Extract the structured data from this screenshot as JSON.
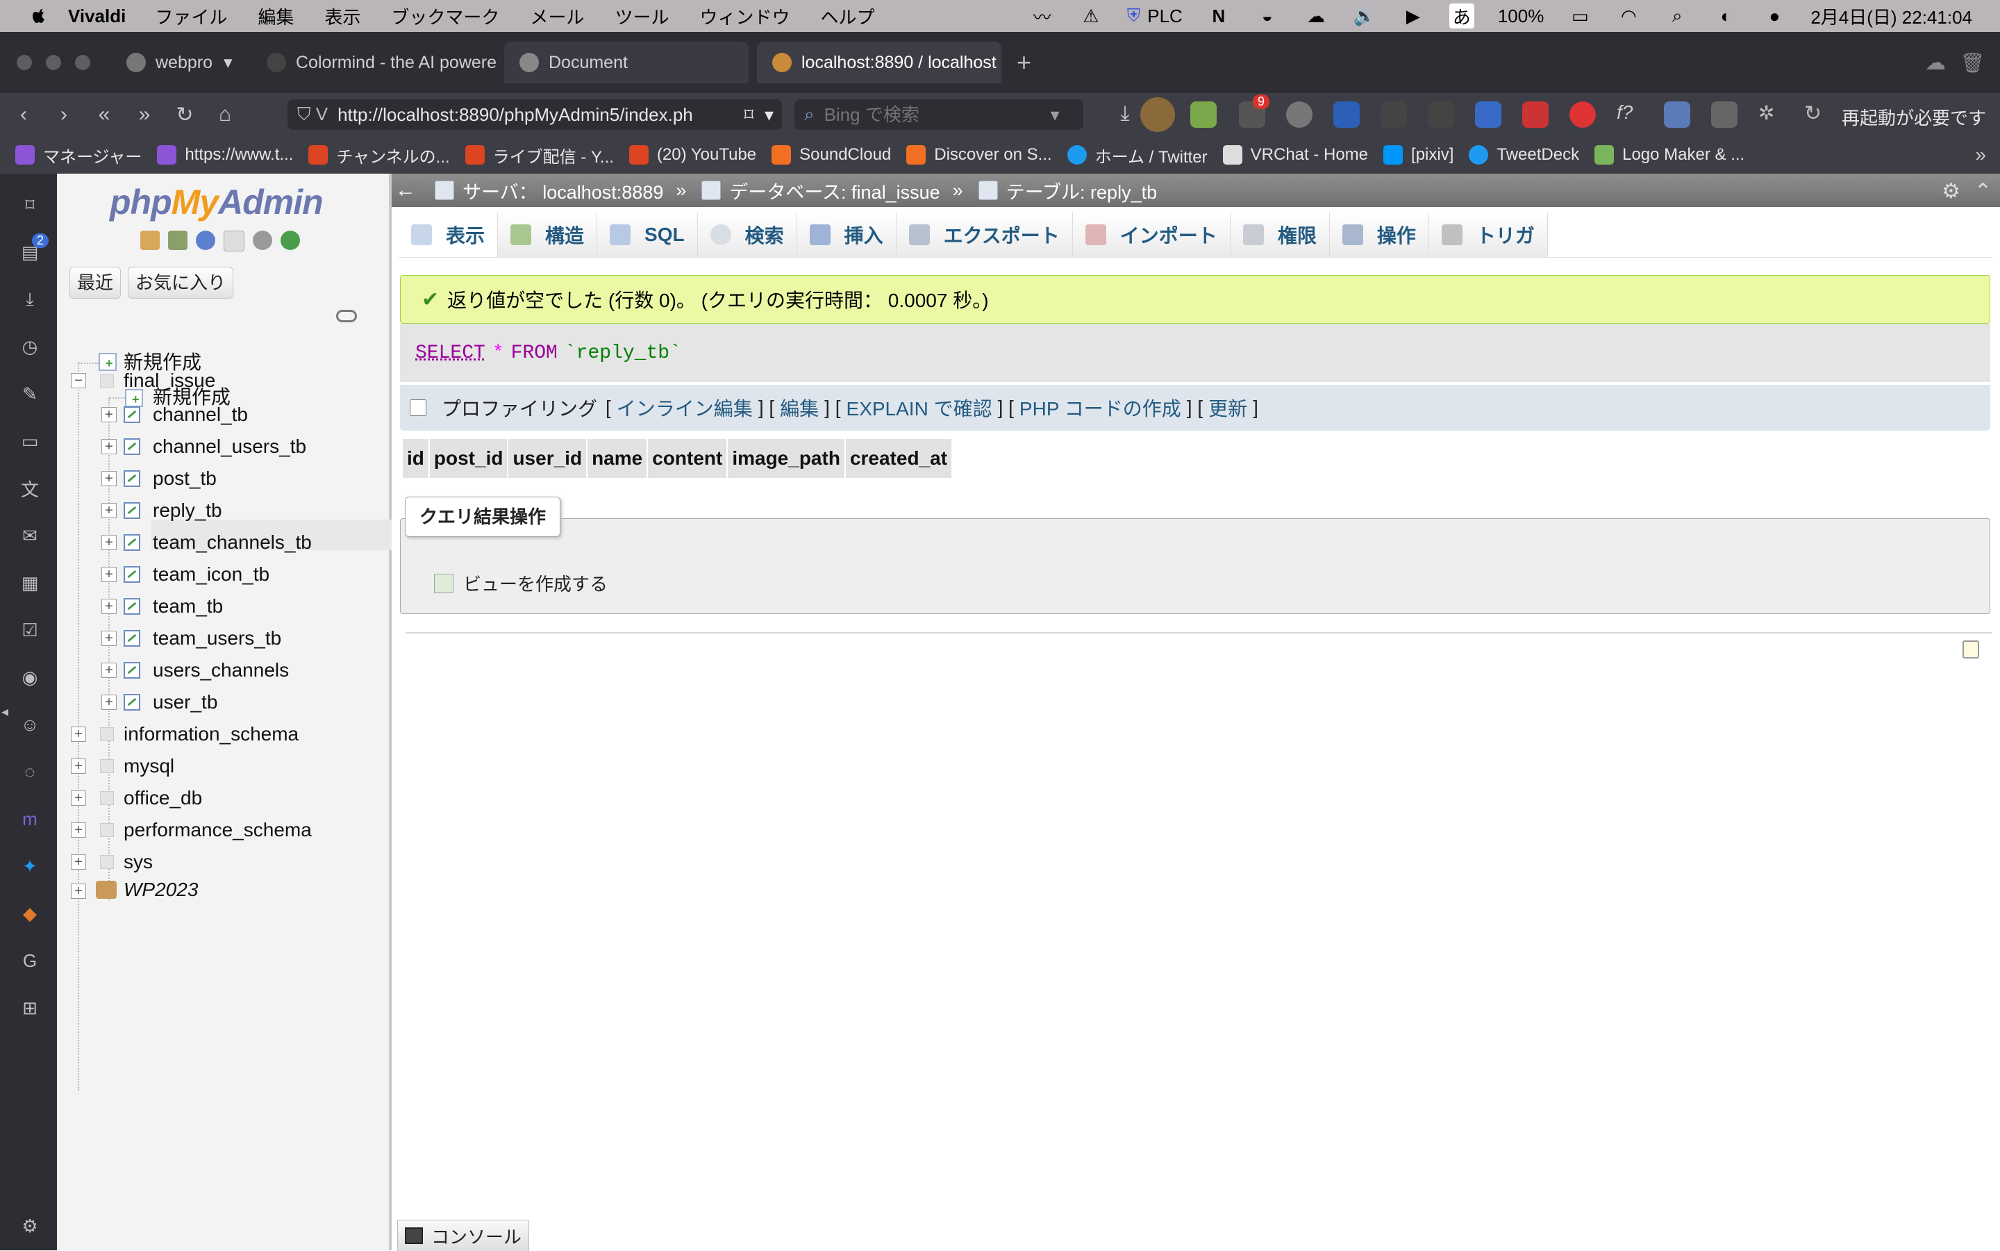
{
  "menubar": {
    "app_name": "Vivaldi",
    "items": [
      "ファイル",
      "編集",
      "表示",
      "ブックマーク",
      "メール",
      "ツール",
      "ウィンドウ",
      "ヘルプ"
    ],
    "plc_label": "PLC",
    "input_mode": "あ",
    "battery": "100%",
    "datetime": "2月4日(日) 22:41:04"
  },
  "tabs": [
    {
      "label": "webpro",
      "active": false
    },
    {
      "label": "Colormind - the AI powered",
      "active": false
    },
    {
      "label": "Document",
      "active": false
    },
    {
      "label": "localhost:8890 / localhost",
      "active": true
    }
  ],
  "addressbar": {
    "url": "http://localhost:8890/phpMyAdmin5/index.ph",
    "search_placeholder": "Bing で検索",
    "badge_count": "9",
    "restart_label": "再起動が必要です"
  },
  "bookmarks": [
    "マネージャー",
    "https://www.t...",
    "チャンネルの...",
    "ライブ配信 - Y...",
    "(20) YouTube",
    "SoundCloud",
    "Discover on S...",
    "ホーム / Twitter",
    "VRChat - Home",
    "[pixiv]",
    "TweetDeck",
    "Logo Maker & ..."
  ],
  "sidepanel": {
    "badge": "2"
  },
  "pma_nav": {
    "logo": {
      "php": "php",
      "my": "My",
      "admin": "Admin"
    },
    "recent_label": "最近",
    "favorites_label": "お気に入り",
    "tree": {
      "new_label": "新規作成",
      "current_db": "final_issue",
      "db_new_label": "新規作成",
      "tables": [
        "channel_tb",
        "channel_users_tb",
        "post_tb",
        "reply_tb",
        "team_channels_tb",
        "team_icon_tb",
        "team_tb",
        "team_users_tb",
        "users_channels",
        "user_tb"
      ],
      "other_dbs": [
        "information_schema",
        "mysql",
        "office_db",
        "performance_schema",
        "sys"
      ],
      "group_db": "WP2023"
    }
  },
  "breadcrumb": {
    "server": "サーバ： localhost:8889",
    "database": "データベース: final_issue",
    "table": "テーブル: reply_tb"
  },
  "topmenu": [
    "表示",
    "構造",
    "SQL",
    "検索",
    "挿入",
    "エクスポート",
    "インポート",
    "権限",
    "操作",
    "トリガ"
  ],
  "result": {
    "message": "返り値が空でした (行数 0)。 (クエリの実行時間： 0.0007 秒。)",
    "sql": {
      "select": "SELECT",
      "star": "*",
      "from": "FROM",
      "table": "`reply_tb`"
    },
    "profiling_label": "プロファイリング",
    "links": [
      "インライン編集",
      "編集",
      "EXPLAIN で確認",
      "PHP コードの作成",
      "更新"
    ],
    "columns": [
      "id",
      "post_id",
      "user_id",
      "name",
      "content",
      "image_path",
      "created_at"
    ]
  },
  "query_ops": {
    "legend": "クエリ結果操作",
    "create_view": "ビューを作成する"
  },
  "console_label": "コンソール",
  "colors": {
    "success_bg": "#ebf8a4",
    "link": "#235a81",
    "sql_keyword": "#990099"
  }
}
